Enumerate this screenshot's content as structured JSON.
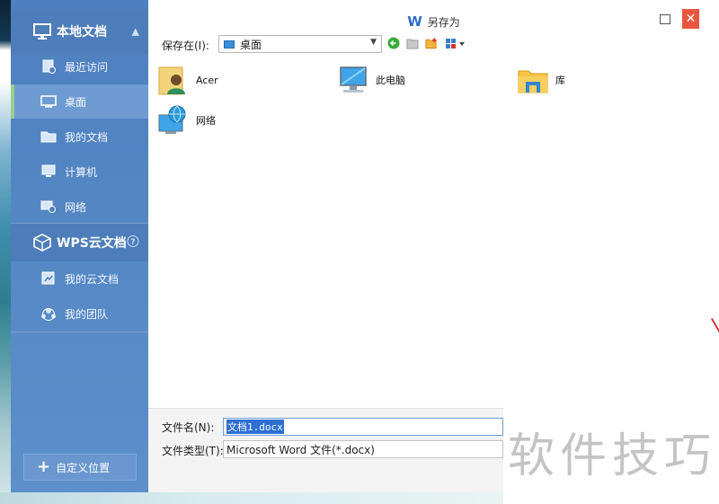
{
  "sidebar": {
    "local_header": "本地文档",
    "local_items": [
      {
        "label": "最近访问",
        "icon": "recent-icon"
      },
      {
        "label": "桌面",
        "icon": "desktop-icon"
      },
      {
        "label": "我的文档",
        "icon": "documents-icon"
      },
      {
        "label": "计算机",
        "icon": "computer-icon"
      },
      {
        "label": "网络",
        "icon": "network-icon"
      }
    ],
    "cloud_header": "WPS云文档",
    "cloud_items": [
      {
        "label": "我的云文档",
        "icon": "cloud-doc-icon"
      },
      {
        "label": "我的团队",
        "icon": "team-icon"
      }
    ],
    "custom_location": "自定义位置",
    "active_item": "桌面"
  },
  "dialog": {
    "title": "另存为",
    "save_in_label": "保存在(I):",
    "location_value": "桌面",
    "files": [
      {
        "name": "Acer",
        "icon": "user-folder-icon"
      },
      {
        "name": "此电脑",
        "icon": "this-pc-icon"
      },
      {
        "name": "库",
        "icon": "library-icon"
      },
      {
        "name": "网络",
        "icon": "network-globe-icon"
      }
    ],
    "filename_label": "文件名(N):",
    "filename_value": "文档1.docx",
    "filetype_label": "文件类型(T):",
    "filetype_value": "Microsoft Word 文件(*.docx)"
  },
  "watermark": "软件技巧",
  "colors": {
    "sidebar": "#5486c4",
    "active_item": "#6e9bd2",
    "active_marker": "#9bd08a",
    "close_button": "#e8573e",
    "selection": "#2d6fd2"
  }
}
